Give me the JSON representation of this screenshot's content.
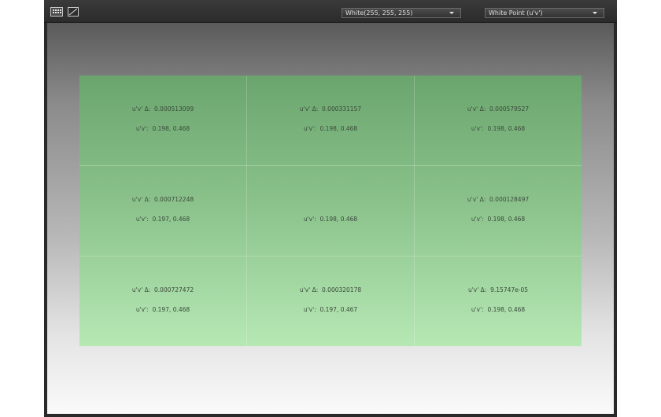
{
  "toolbar": {
    "grid_icon": "grid-icon",
    "curve_icon": "curve-icon",
    "color_dropdown": "White(255, 255, 255)",
    "mode_dropdown": "White Point (u'v')"
  },
  "cells": [
    {
      "delta_label": "u'v' Δ:",
      "delta_value": "0.000513099",
      "uv_label": "u'v':",
      "uv_value": "0.198, 0.468"
    },
    {
      "delta_label": "u'v' Δ:",
      "delta_value": "0.000331157",
      "uv_label": "u'v':",
      "uv_value": "0.198, 0.468"
    },
    {
      "delta_label": "u'v' Δ:",
      "delta_value": "0.000579527",
      "uv_label": "u'v':",
      "uv_value": "0.198, 0.468"
    },
    {
      "delta_label": "u'v' Δ:",
      "delta_value": "0.000712248",
      "uv_label": "u'v':",
      "uv_value": "0.197, 0.468"
    },
    {
      "delta_label": "",
      "delta_value": "",
      "uv_label": "u'v':",
      "uv_value": "0.198, 0.468"
    },
    {
      "delta_label": "u'v' Δ:",
      "delta_value": "0.000128497",
      "uv_label": "u'v':",
      "uv_value": "0.198, 0.468"
    },
    {
      "delta_label": "u'v' Δ:",
      "delta_value": "0.000727472",
      "uv_label": "u'v':",
      "uv_value": "0.197, 0.468"
    },
    {
      "delta_label": "u'v' Δ:",
      "delta_value": "0.000320178",
      "uv_label": "u'v':",
      "uv_value": "0.197, 0.467"
    },
    {
      "delta_label": "u'v' Δ:",
      "delta_value": "9.15747e-05",
      "uv_label": "u'v':",
      "uv_value": "0.198, 0.468"
    }
  ],
  "colors": {
    "panel_top": "#6ba56e",
    "panel_bottom": "#b6e8b4",
    "toolbar_bg": "#2b2b2b"
  }
}
